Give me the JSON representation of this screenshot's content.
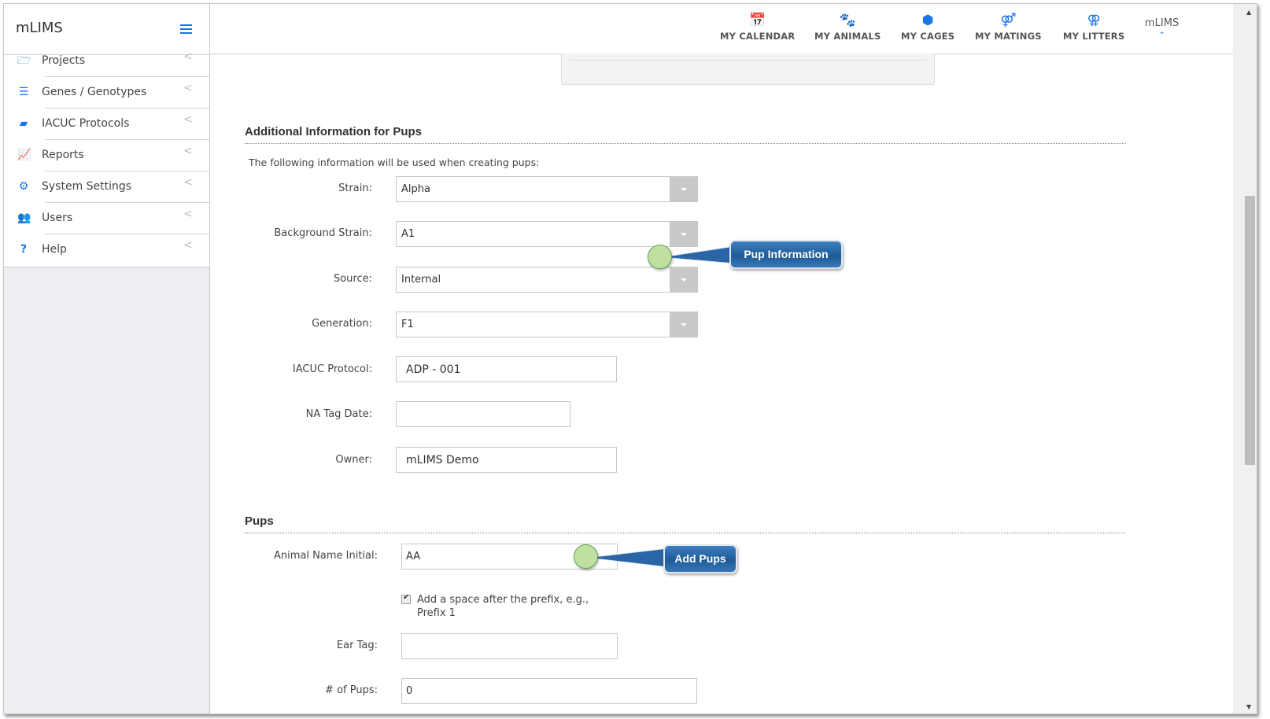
{
  "app": {
    "brand": "mLIMS"
  },
  "sidebar": {
    "items": [
      {
        "label": "Projects",
        "icon": "folder-open-icon",
        "glyph": "🗁"
      },
      {
        "label": "Genes / Genotypes",
        "icon": "list-icon",
        "glyph": "☰"
      },
      {
        "label": "IACUC Protocols",
        "icon": "book-icon",
        "glyph": "▰"
      },
      {
        "label": "Reports",
        "icon": "line-chart-icon",
        "glyph": "📈"
      },
      {
        "label": "System Settings",
        "icon": "gear-icon",
        "glyph": "⚙"
      },
      {
        "label": "Users",
        "icon": "users-icon",
        "glyph": "👥"
      },
      {
        "label": "Help",
        "icon": "question-icon",
        "glyph": "?"
      }
    ],
    "chevron": "<"
  },
  "header": {
    "nav": [
      {
        "label": "MY CALENDAR",
        "icon": "calendar-icon",
        "glyph": "📅"
      },
      {
        "label": "MY ANIMALS",
        "icon": "paw-icon",
        "glyph": "🐾"
      },
      {
        "label": "MY CAGES",
        "icon": "cube-icon",
        "glyph": "⬢"
      },
      {
        "label": "MY MATINGS",
        "icon": "mars-venus-icon",
        "glyph": "⚤"
      },
      {
        "label": "MY LITTERS",
        "icon": "venus-double-icon",
        "glyph": "⚢"
      }
    ],
    "user": {
      "name": "mLIMS",
      "caret": "⌄"
    }
  },
  "section_pup_info": {
    "title": "Additional Information for Pups",
    "intro": "The following information will be used when creating pups:",
    "fields": {
      "strain": {
        "label": "Strain:",
        "value": "Alpha"
      },
      "background_strain": {
        "label": "Background Strain:",
        "value": "A1"
      },
      "source": {
        "label": "Source:",
        "value": "Internal"
      },
      "generation": {
        "label": "Generation:",
        "value": "F1"
      },
      "iacuc_protocol": {
        "label": "IACUC Protocol:",
        "value": "ADP - 001"
      },
      "na_tag_date": {
        "label": "NA Tag Date:",
        "value": ""
      },
      "owner": {
        "label": "Owner:",
        "value": "mLIMS Demo"
      }
    }
  },
  "section_pups": {
    "title": "Pups",
    "fields": {
      "animal_name_initial": {
        "label": "Animal Name Initial:",
        "value": "AA"
      },
      "add_space_checkbox": {
        "label": "Add a space after the prefix, e.g., Prefix 1",
        "checked": true
      },
      "ear_tag": {
        "label": "Ear Tag:",
        "value": ""
      },
      "num_pups": {
        "label": "# of Pups:",
        "value": "0"
      }
    }
  },
  "callouts": {
    "pup_information": "Pup Information",
    "add_pups": "Add Pups"
  },
  "scrollbar": {
    "position_fraction": 0.27
  },
  "colors": {
    "accent": "#1a73e8",
    "callout": "#1e5a98",
    "marker": "#bfe0a0"
  }
}
